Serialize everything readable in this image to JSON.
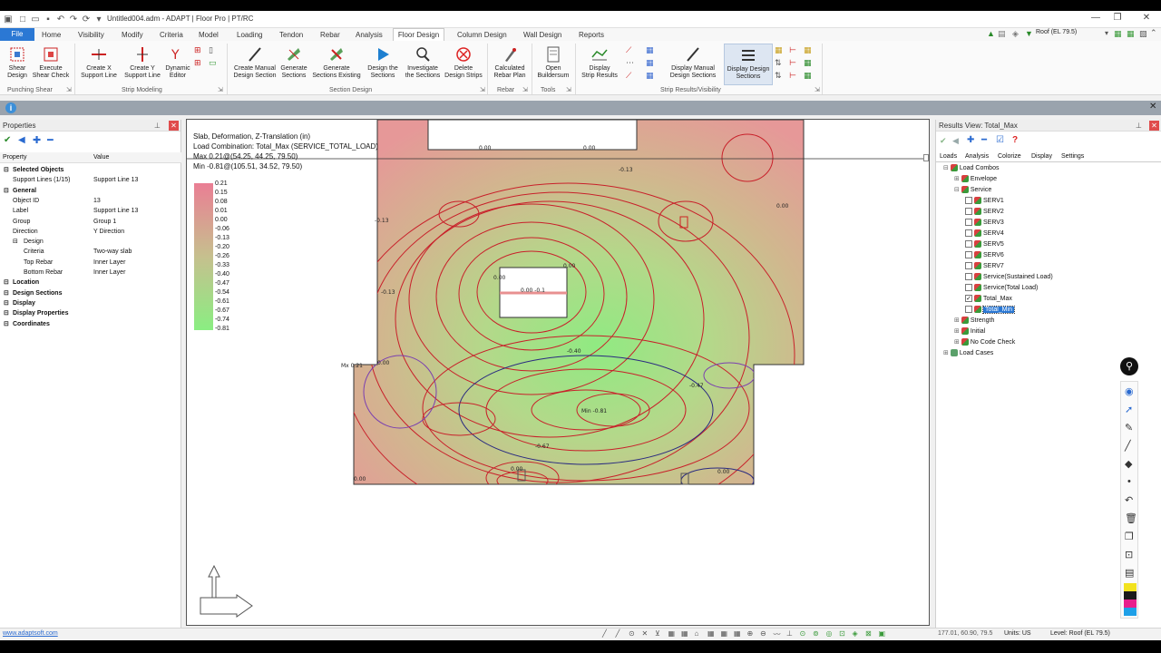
{
  "app": {
    "title": "Untitled004.adm - ADAPT | Floor Pro | PT/RC",
    "level_selector": "Roof (EL 79.5)"
  },
  "menu": [
    "File",
    "Home",
    "Visibility",
    "Modify",
    "Criteria",
    "Model",
    "Loading",
    "Tendon",
    "Rebar",
    "Analysis",
    "Floor Design",
    "Column Design",
    "Wall Design",
    "Reports"
  ],
  "ribbon": {
    "buttons": {
      "shear_design": [
        "Shear",
        "Design"
      ],
      "execute_shear": [
        "Execute",
        "Shear Check"
      ],
      "create_x": [
        "Create X",
        "Support Line"
      ],
      "create_y": [
        "Create Y",
        "Support Line"
      ],
      "dynamic_editor": [
        "Dynamic",
        "Editor"
      ],
      "create_manual": [
        "Create Manual",
        "Design Section"
      ],
      "generate_sections": [
        "Generate",
        "Sections"
      ],
      "generate_existing": [
        "Generate",
        "Sections Existing"
      ],
      "design_sections": [
        "Design the",
        "Sections"
      ],
      "investigate": [
        "Investigate",
        "the Sections"
      ],
      "delete_strips": [
        "Delete",
        "Design Strips"
      ],
      "calc_rebar": [
        "Calculated",
        "Rebar Plan"
      ],
      "open_buildersum": [
        "Open",
        "Buildersum"
      ],
      "display_strip": [
        "Display",
        "Strip Results"
      ],
      "display_manual": [
        "Display Manual",
        "Design Sections"
      ],
      "display_design": [
        "Display Design",
        "Sections"
      ]
    },
    "groups": {
      "punching": "Punching Shear",
      "strip_modeling": "Strip Modeling",
      "section_design": "Section Design",
      "rebar": "Rebar",
      "tools": "Tools",
      "strip_results": "Strip Results/Visibility"
    }
  },
  "properties": {
    "title": "Properties",
    "col_property": "Property",
    "col_value": "Value",
    "rows": [
      {
        "k": "Selected Objects",
        "v": "",
        "type": "cat"
      },
      {
        "k": "Support Lines (1/15)",
        "v": "Support Line 13",
        "type": "item"
      },
      {
        "k": "General",
        "v": "",
        "type": "cat"
      },
      {
        "k": "Object ID",
        "v": "13",
        "type": "item"
      },
      {
        "k": "Label",
        "v": "Support Line 13",
        "type": "item"
      },
      {
        "k": "Group",
        "v": "Group 1",
        "type": "item"
      },
      {
        "k": "Direction",
        "v": "Y Direction",
        "type": "item"
      },
      {
        "k": "Design",
        "v": "",
        "type": "sub"
      },
      {
        "k": "Criteria",
        "v": "Two-way slab",
        "type": "sub2"
      },
      {
        "k": "Top Rebar",
        "v": "Inner Layer",
        "type": "sub2"
      },
      {
        "k": "Bottom Rebar",
        "v": "Inner Layer",
        "type": "sub2"
      },
      {
        "k": "Location",
        "v": "",
        "type": "cat"
      },
      {
        "k": "Design Sections",
        "v": "",
        "type": "cat"
      },
      {
        "k": "Display",
        "v": "",
        "type": "cat"
      },
      {
        "k": "Display Properties",
        "v": "",
        "type": "cat"
      },
      {
        "k": "Coordinates",
        "v": "",
        "type": "cat"
      }
    ]
  },
  "viewport": {
    "line1": "Slab, Deformation, Z-Translation (in)",
    "line2": "Load Combination: Total_Max (SERVICE_TOTAL_LOAD)",
    "line3": "Max 0.21@(54.25, 44.25, 79.50)",
    "line4": "Min -0.81@(105.51, 34.52, 79.50)",
    "legend": [
      "0.21",
      "0.15",
      "0.08",
      "0.01",
      "0.00",
      "-0.06",
      "-0.13",
      "-0.20",
      "-0.26",
      "-0.33",
      "-0.40",
      "-0.47",
      "-0.54",
      "-0.61",
      "-0.67",
      "-0.74",
      "-0.81"
    ],
    "min_label": "Min -0.81",
    "max_label": "Mx 0.21",
    "contour_labels": [
      "0.00",
      "0.00",
      "-0.13",
      "-0.13",
      "0.00",
      "0.00 -0.1",
      "0.00",
      "-0.13",
      "-0.40",
      "-0.47",
      "-0.67",
      "0.00",
      "0.00",
      "0.00",
      "0.00",
      "0.00"
    ]
  },
  "results": {
    "title": "Results View: Total_Max",
    "tabs": [
      "Loads",
      "Analysis",
      "Colorize",
      "Display",
      "Settings"
    ],
    "tree": {
      "load_combos": "Load Combos",
      "envelope": "Envelope",
      "service": "Service",
      "serv": [
        "SERV1",
        "SERV2",
        "SERV3",
        "SERV4",
        "SERV5",
        "SERV6",
        "SERV7"
      ],
      "sustained": "Service(Sustained Load)",
      "total_load": "Service(Total Load)",
      "total_max": "Total_Max",
      "total_min": "Total_Min",
      "strength": "Strength",
      "initial": "Initial",
      "no_code": "No Code Check",
      "load_cases": "Load Cases"
    }
  },
  "status": {
    "link": "www.adaptsoft.com",
    "coords": "177.01, 60.90, 79.5",
    "units": "Units: US",
    "level": "Level: Roof (EL 79.5)"
  },
  "colors": {
    "accent": "#2b78d4",
    "slab_pink": "#e89a9a",
    "slab_green": "#9ae58a",
    "contour": "#c8202a"
  }
}
